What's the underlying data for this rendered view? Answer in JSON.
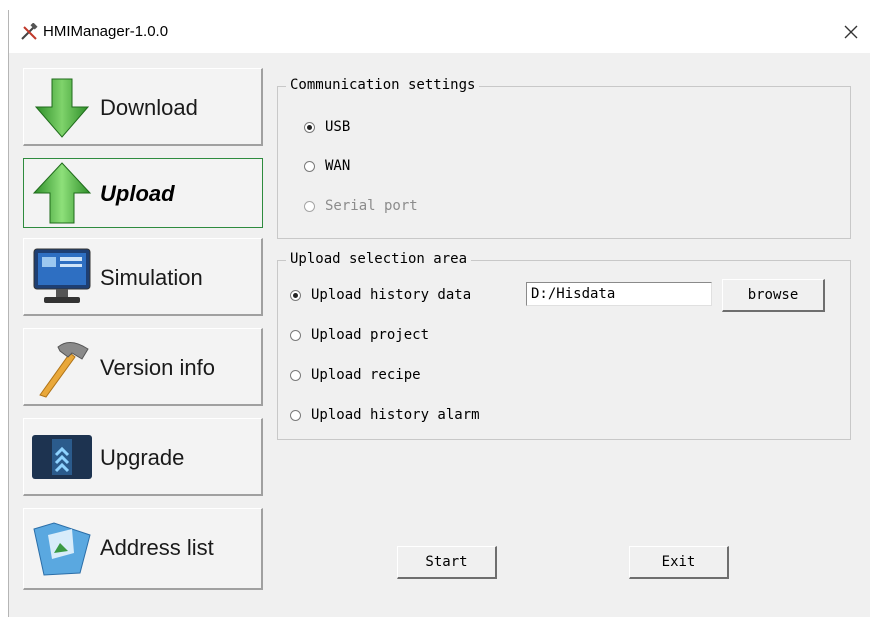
{
  "window": {
    "title": "HMIManager-1.0.0"
  },
  "nav": {
    "download": "Download",
    "upload": "Upload",
    "simulation": "Simulation",
    "version_info": "Version info",
    "upgrade": "Upgrade",
    "address_list": "Address list",
    "active": "Upload"
  },
  "communication": {
    "title": "Communication settings",
    "options": [
      "USB",
      "WAN",
      "Serial port"
    ],
    "selected": "USB",
    "disabled": [
      "Serial port"
    ]
  },
  "upload_area": {
    "title": "Upload selection area",
    "options": [
      "Upload history data",
      "Upload project",
      "Upload recipe",
      "Upload history alarm"
    ],
    "selected": "Upload history data",
    "path_value": "D:/Hisdata",
    "browse_label": "browse"
  },
  "actions": {
    "start_label": "Start",
    "exit_label": "Exit"
  },
  "colors": {
    "active_border": "#2e8b3e",
    "arrow_green": "#3aa635"
  },
  "icons": {
    "title": "tools-icon",
    "download": "down-arrow-icon",
    "upload": "up-arrow-icon",
    "simulation": "monitor-icon",
    "version_info": "hammer-icon",
    "upgrade": "upgrade-chevron-icon",
    "address_list": "folder-icon",
    "close": "close-icon"
  }
}
